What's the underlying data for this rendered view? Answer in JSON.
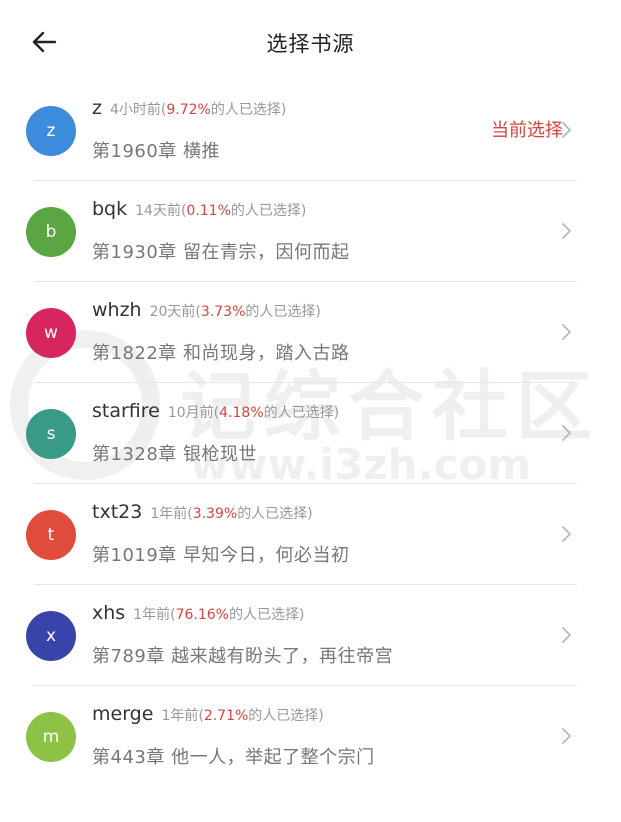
{
  "header": {
    "title": "选择书源"
  },
  "icons": {
    "back": "arrow-left-icon",
    "row_action": "chevron-right-icon"
  },
  "colors": {
    "highlight": "#d9433f"
  },
  "watermark": {
    "text": "记综合社区",
    "url": "www.i3zh.com"
  },
  "sources": [
    {
      "initial": "z",
      "name": "z",
      "time": "4小时前(",
      "percent": "9.72%",
      "suffix": "的人已选择)",
      "chapter": "第1960章 横推",
      "avatar_color": "#3d8bdc",
      "current_label": "当前选择"
    },
    {
      "initial": "b",
      "name": "bqk",
      "time": "14天前(",
      "percent": "0.11%",
      "suffix": "的人已选择)",
      "chapter": "第1930章 留在青宗，因何而起",
      "avatar_color": "#5aa643"
    },
    {
      "initial": "w",
      "name": "whzh",
      "time": "20天前(",
      "percent": "3.73%",
      "suffix": "的人已选择)",
      "chapter": "第1822章 和尚现身，踏入古路",
      "avatar_color": "#d7265e"
    },
    {
      "initial": "s",
      "name": "starfire",
      "time": "10月前(",
      "percent": "4.18%",
      "suffix": "的人已选择)",
      "chapter": "第1328章 银枪现世",
      "avatar_color": "#389a87"
    },
    {
      "initial": "t",
      "name": "txt23",
      "time": "1年前(",
      "percent": "3.39%",
      "suffix": "的人已选择)",
      "chapter": "第1019章 早知今日，何必当初",
      "avatar_color": "#e04c3c"
    },
    {
      "initial": "x",
      "name": "xhs",
      "time": "1年前(",
      "percent": "76.16%",
      "suffix": "的人已选择)",
      "chapter": "第789章 越来越有盼头了，再往帝宫",
      "avatar_color": "#3944aa"
    },
    {
      "initial": "m",
      "name": "merge",
      "time": "1年前(",
      "percent": "2.71%",
      "suffix": "的人已选择)",
      "chapter": "第443章 他一人，举起了整个宗门",
      "avatar_color": "#8ec246"
    }
  ]
}
